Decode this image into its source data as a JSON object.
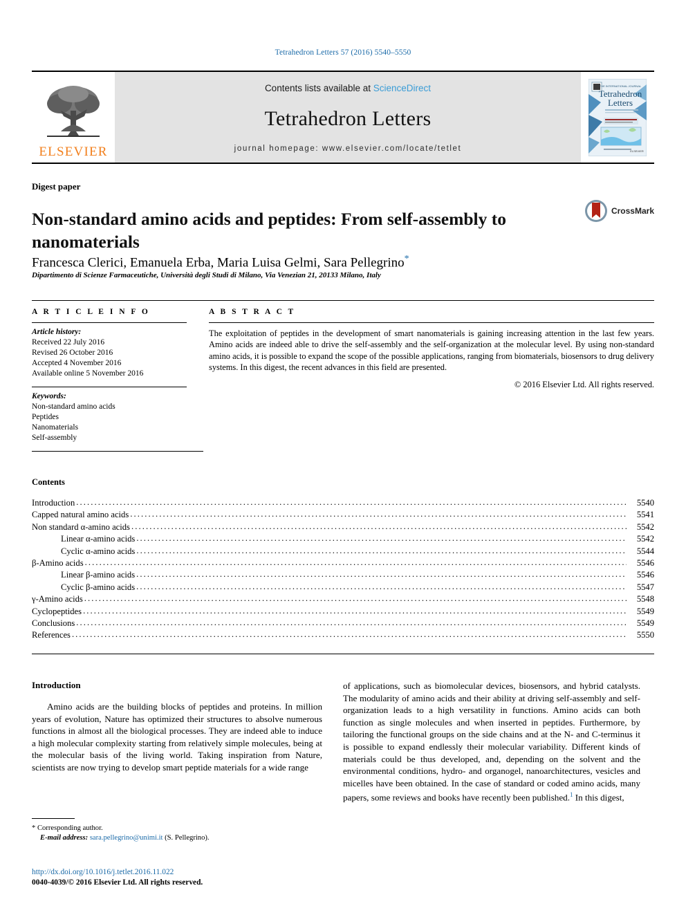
{
  "running_head": "Tetrahedron Letters 57 (2016) 5540–5550",
  "masthead": {
    "contents_prefix": "Contents lists available at ",
    "sciencedirect": "ScienceDirect",
    "journal_name": "Tetrahedron Letters",
    "homepage": "journal homepage: www.elsevier.com/locate/tetlet",
    "publisher": "ELSEVIER",
    "cover_title_line1": "Tetrahedron",
    "cover_title_line2": "Letters",
    "colors": {
      "elsevier_orange": "#F27F1C",
      "link_blue": "#1a6aa8",
      "sciencedirect_blue": "#3a9cd6",
      "band_grey": "#e3e3e3"
    }
  },
  "article": {
    "type_label": "Digest paper",
    "title": "Non-standard amino acids and peptides: From self-assembly to nanomaterials",
    "authors": "Francesca Clerici, Emanuela Erba, Maria Luisa Gelmi, Sara Pellegrino",
    "corresponding_marker": "*",
    "affiliation": "Dipartimento di Scienze Farmaceutiche, Università degli Studi di Milano, Via Venezian 21, 20133 Milano, Italy",
    "crossmark_label": "CrossMark"
  },
  "article_info": {
    "heading": "A R T I C L E   I N F O",
    "history_label": "Article history:",
    "history": [
      "Received 22 July 2016",
      "Revised 26 October 2016",
      "Accepted 4 November 2016",
      "Available online 5 November 2016"
    ],
    "keywords_label": "Keywords:",
    "keywords": [
      "Non-standard amino acids",
      "Peptides",
      "Nanomaterials",
      "Self-assembly"
    ]
  },
  "abstract": {
    "heading": "A B S T R A C T",
    "text": "The exploitation of peptides in the development of smart nanomaterials is gaining increasing attention in the last few years. Amino acids are indeed able to drive the self-assembly and the self-organization at the molecular level. By using non-standard amino acids, it is possible to expand the scope of the possible applications, ranging from biomaterials, biosensors to drug delivery systems. In this digest, the recent advances in this field are presented.",
    "copyright": "© 2016 Elsevier Ltd. All rights reserved."
  },
  "contents": {
    "title": "Contents",
    "entries": [
      {
        "label": "Introduction",
        "page": "5540",
        "indent": 0
      },
      {
        "label": "Capped natural amino acids",
        "page": "5541",
        "indent": 0
      },
      {
        "label": "Non standard α-amino acids",
        "page": "5542",
        "indent": 0
      },
      {
        "label": "Linear α-amino acids",
        "page": "5542",
        "indent": 1
      },
      {
        "label": "Cyclic α-amino acids",
        "page": "5544",
        "indent": 1
      },
      {
        "label": "β-Amino acids",
        "page": "5546",
        "indent": 0
      },
      {
        "label": "Linear β-amino acids",
        "page": "5546",
        "indent": 1
      },
      {
        "label": "Cyclic β-amino acids",
        "page": "5547",
        "indent": 1
      },
      {
        "label": "γ-Amino acids",
        "page": "5548",
        "indent": 0
      },
      {
        "label": "Cyclopeptides",
        "page": "5549",
        "indent": 0
      },
      {
        "label": "Conclusions",
        "page": "5549",
        "indent": 0
      },
      {
        "label": "References",
        "page": "5550",
        "indent": 0
      }
    ]
  },
  "introduction": {
    "heading": "Introduction",
    "left_paragraph": "Amino acids are the building blocks of peptides and proteins. In million years of evolution, Nature has optimized their structures to absolve numerous functions in almost all the biological processes. They are indeed able to induce a high molecular complexity starting from relatively simple molecules, being at the molecular basis of the living world. Taking inspiration from Nature, scientists are now trying to develop smart peptide materials for a wide range",
    "right_paragraph_a": "of applications, such as biomolecular devices, biosensors, and hybrid catalysts. The modularity of amino acids and their ability at driving self-assembly and self-organization leads to a high versatility in functions. Amino acids can both function as single molecules and when inserted in peptides. Furthermore, by tailoring the functional groups on the side chains and at the N- and C-terminus it is possible to expand endlessly their molecular variability. Different kinds of materials could be thus developed, and, depending on the solvent and the environmental conditions, hydro- and organogel, nanoarchitectures, vesicles and micelles have been obtained. In the case of standard or coded amino acids, many papers, some reviews and books have recently been published.",
    "right_citation": "1",
    "right_paragraph_b": " In this digest,"
  },
  "footnote": {
    "marker": "*",
    "corresponding": "Corresponding author.",
    "email_label": "E-mail address:",
    "email": "sara.pellegrino@unimi.it",
    "email_owner": "(S. Pellegrino)."
  },
  "footer": {
    "doi": "http://dx.doi.org/10.1016/j.tetlet.2016.11.022",
    "issn_line": "0040-4039/© 2016 Elsevier Ltd. All rights reserved."
  }
}
